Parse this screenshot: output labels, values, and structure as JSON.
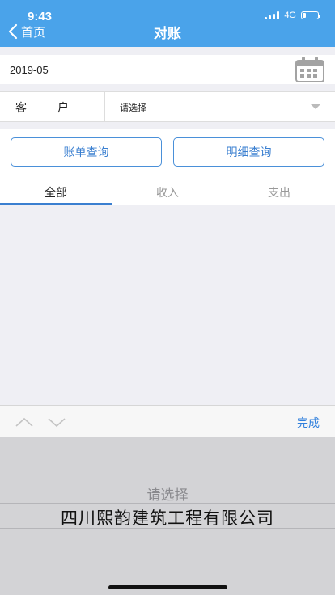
{
  "status_bar": {
    "time": "9:43",
    "network": "4G",
    "battery_level": 0.2
  },
  "nav": {
    "back_label": "首页",
    "title": "对账"
  },
  "date_field": {
    "value": "2019-05",
    "icon": "calendar-icon"
  },
  "customer_field": {
    "label": "客户",
    "value": "请选择"
  },
  "buttons": {
    "bill_query": "账单查询",
    "detail_query": "明细查询"
  },
  "tabs": [
    {
      "label": "全部",
      "active": true
    },
    {
      "label": "收入",
      "active": false
    },
    {
      "label": "支出",
      "active": false
    }
  ],
  "picker_toolbar": {
    "done_label": "完成"
  },
  "picker": {
    "option_above": "请选择",
    "selected": "四川熙韵建筑工程有限公司"
  },
  "colors": {
    "header_bg": "#4aa3ea",
    "accent": "#3a7fd0",
    "done": "#2f7fdc"
  }
}
